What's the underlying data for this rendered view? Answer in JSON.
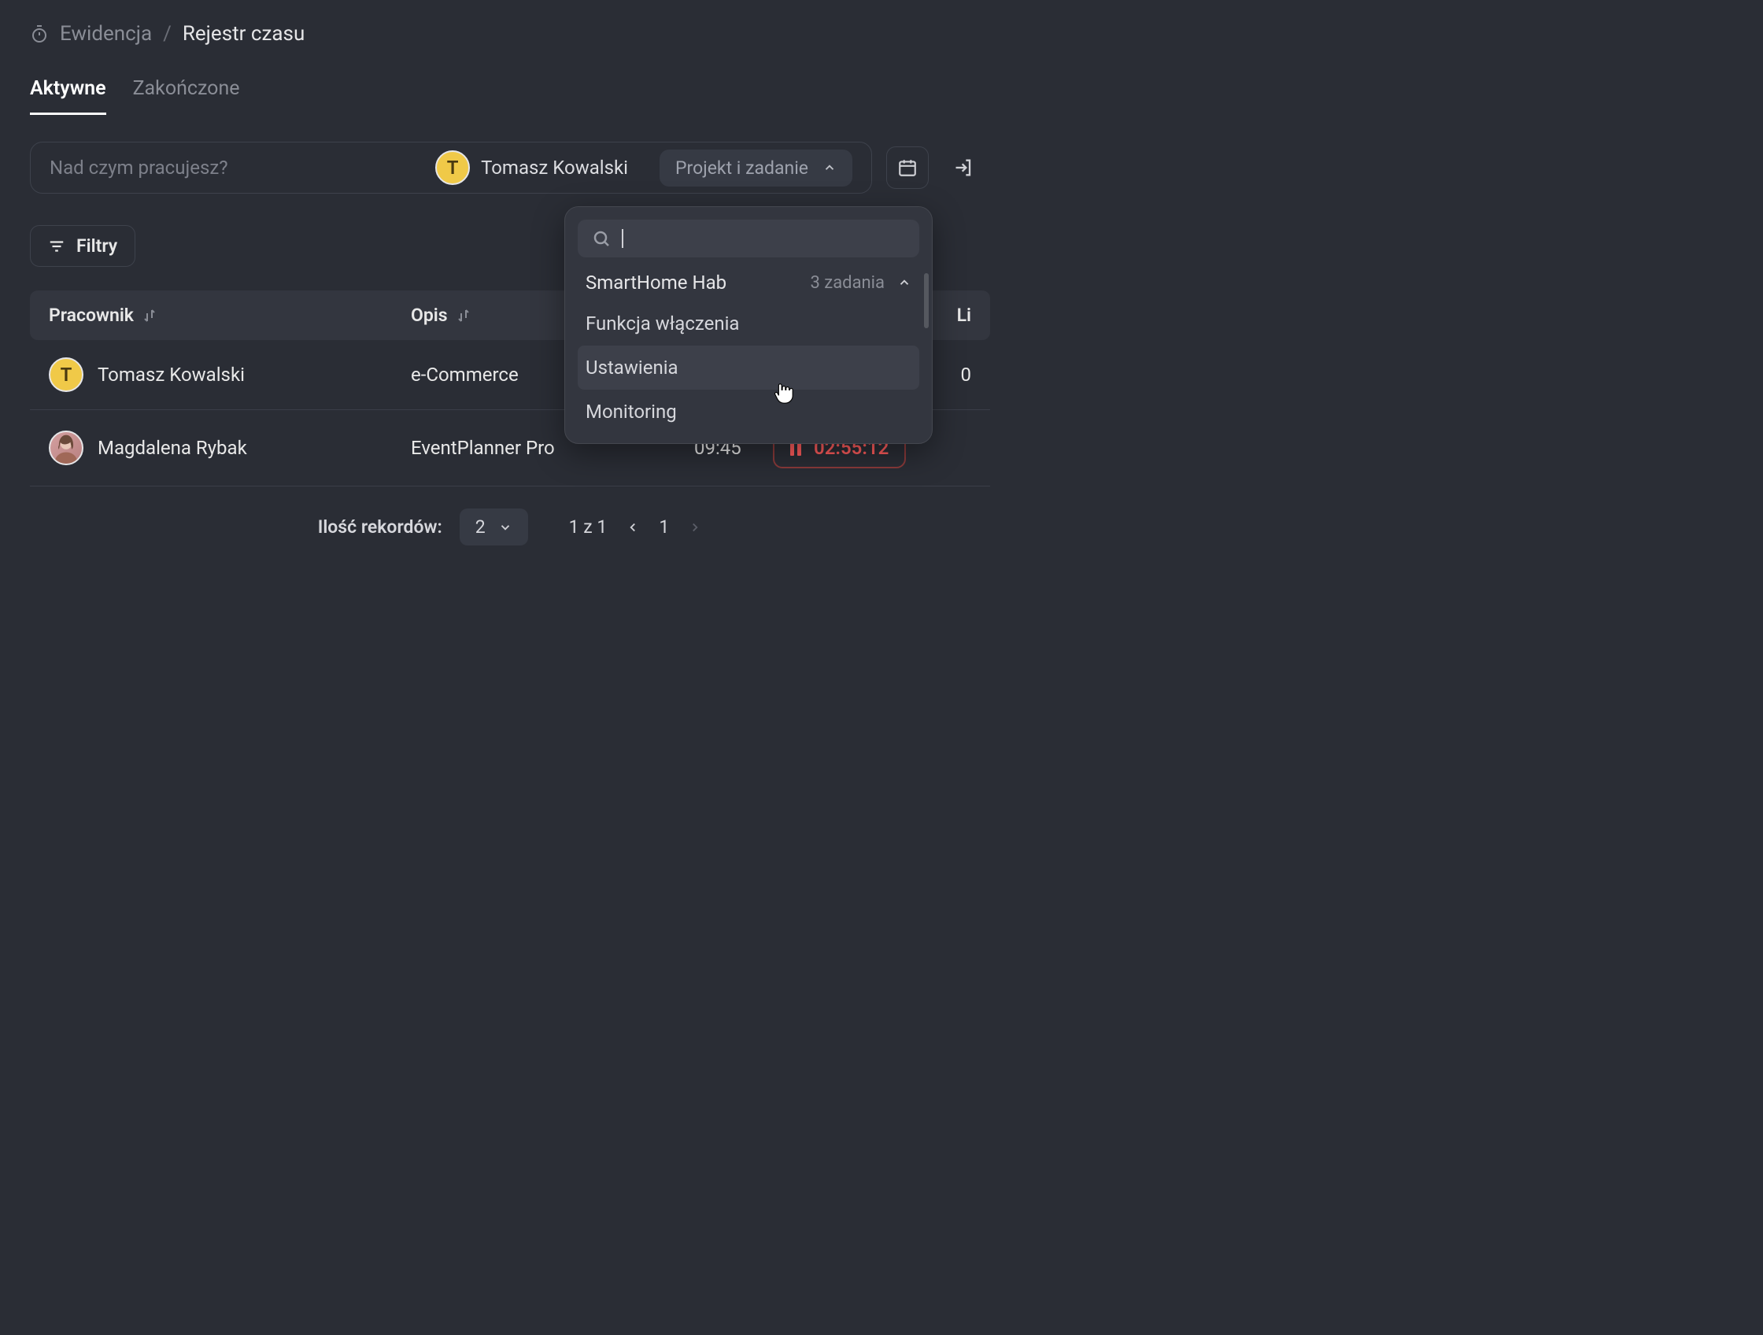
{
  "breadcrumb": {
    "section": "Ewidencja",
    "page": "Rejestr czasu"
  },
  "tabs": {
    "active": "Aktywne",
    "done": "Zakończone"
  },
  "entry": {
    "placeholder": "Nad czym pracujesz?",
    "user_initial": "T",
    "user_name": "Tomasz Kowalski",
    "project_label": "Projekt i zadanie"
  },
  "filters_label": "Filtry",
  "columns": {
    "worker": "Pracownik",
    "desc": "Opis",
    "right": "Li"
  },
  "rows": [
    {
      "initial": "T",
      "name": "Tomasz Kowalski",
      "desc": "e-Commerce",
      "start": "",
      "timer": "",
      "right0": "0"
    },
    {
      "initial": "",
      "name": "Magdalena Rybak",
      "desc": "EventPlanner Pro",
      "start": "09:45",
      "timer": "02:55:12"
    }
  ],
  "pagination": {
    "label": "Ilość rekordów:",
    "page_size": "2",
    "range": "1 z 1",
    "current": "1"
  },
  "popover": {
    "group": "SmartHome Hab",
    "count": "3 zadania",
    "tasks": [
      "Funkcja włączenia",
      "Ustawienia",
      "Monitoring"
    ]
  }
}
